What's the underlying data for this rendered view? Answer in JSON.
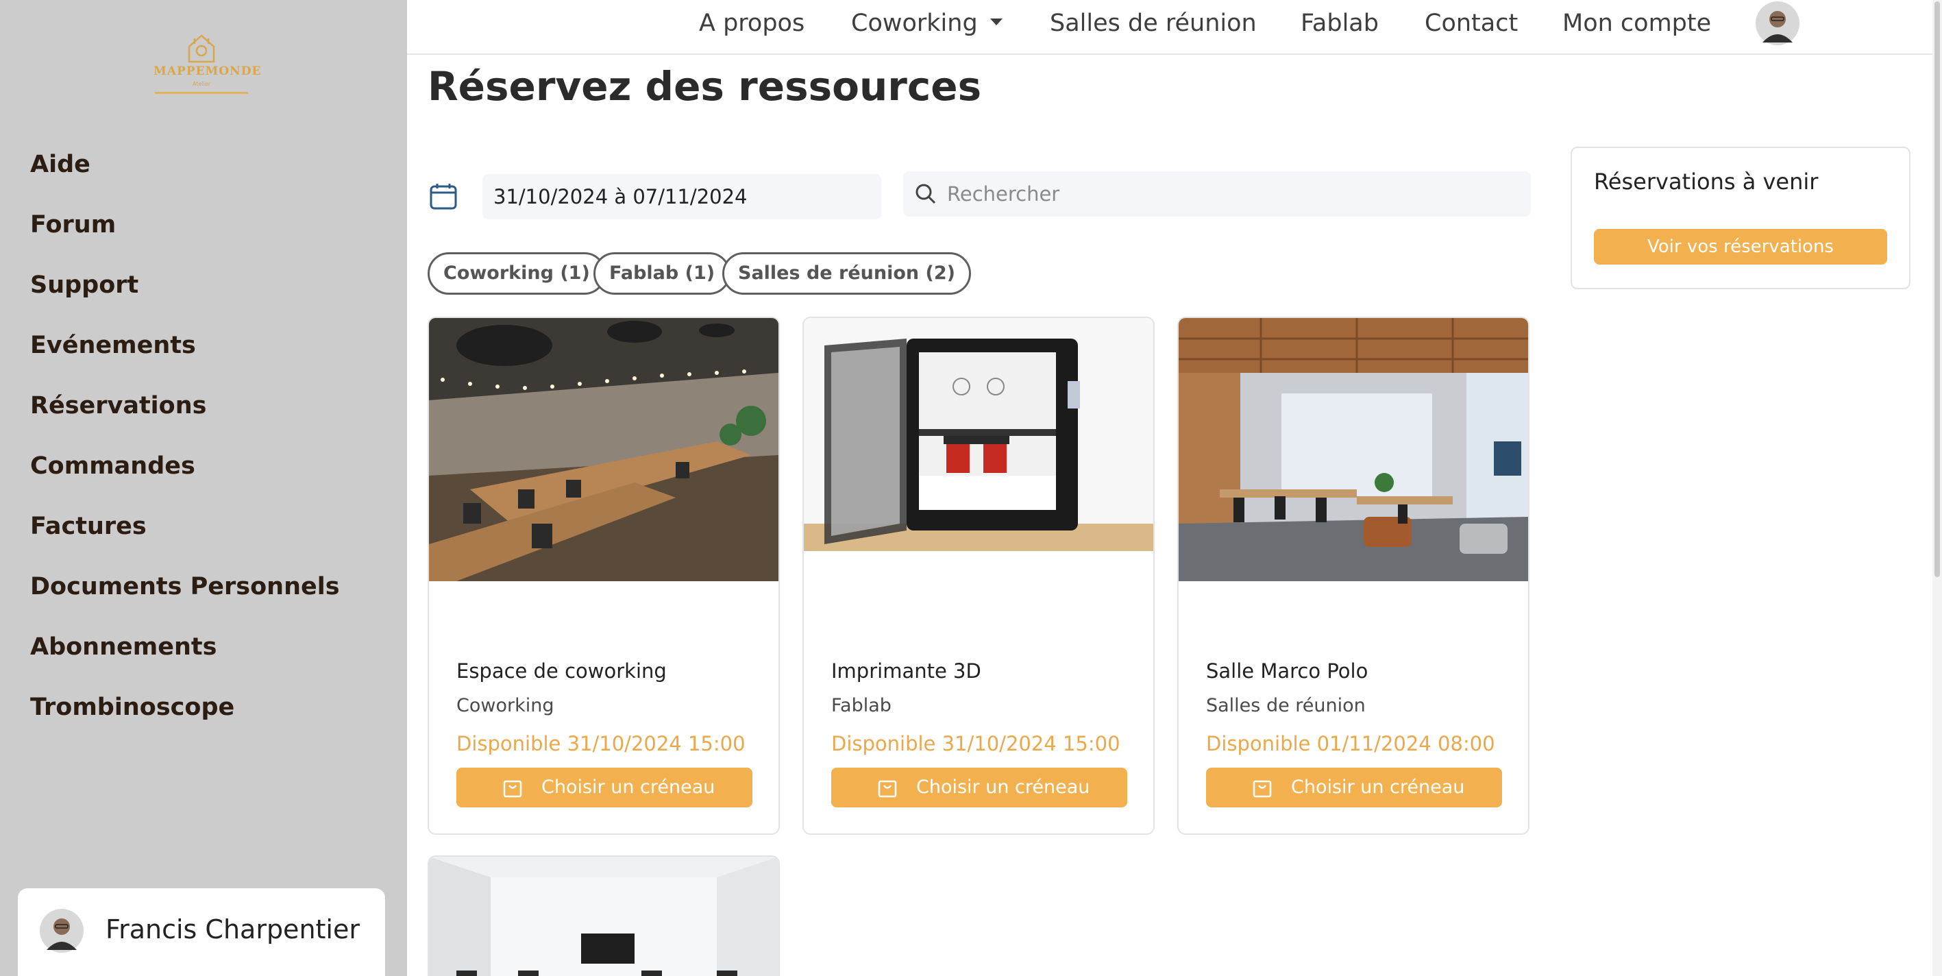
{
  "brand": {
    "name": "MAPPEMONDE",
    "sub": "Atelier"
  },
  "sidebar": {
    "items": [
      {
        "label": "Aide"
      },
      {
        "label": "Forum"
      },
      {
        "label": "Support"
      },
      {
        "label": "Evénements"
      },
      {
        "label": "Réservations"
      },
      {
        "label": "Commandes"
      },
      {
        "label": "Factures"
      },
      {
        "label": "Documents Personnels"
      },
      {
        "label": "Abonnements"
      },
      {
        "label": "Trombinoscope"
      }
    ],
    "user": {
      "name": "Francis Charpentier"
    }
  },
  "topnav": {
    "items": [
      {
        "label": "A propos"
      },
      {
        "label": "Coworking"
      },
      {
        "label": "Salles de réunion"
      },
      {
        "label": "Fablab"
      },
      {
        "label": "Contact"
      },
      {
        "label": "Mon compte"
      }
    ]
  },
  "main": {
    "title": "Réservez des ressources",
    "date_range": "31/10/2024 à 07/11/2024",
    "search": {
      "placeholder": "Rechercher",
      "value": ""
    },
    "filters": [
      {
        "label": "Coworking (1)"
      },
      {
        "label": "Fablab (1)"
      },
      {
        "label": "Salles de réunion (2)"
      }
    ],
    "cards": [
      {
        "title": "Espace de coworking",
        "category": "Coworking",
        "availability": "Disponible 31/10/2024 15:00",
        "button": "Choisir un créneau"
      },
      {
        "title": "Imprimante 3D",
        "category": "Fablab",
        "availability": "Disponible 31/10/2024 15:00",
        "button": "Choisir un créneau"
      },
      {
        "title": "Salle Marco Polo",
        "category": "Salles de réunion",
        "availability": "Disponible 01/11/2024 08:00",
        "button": "Choisir un créneau"
      }
    ]
  },
  "upcoming": {
    "title": "Réservations à venir",
    "button": "Voir vos réservations"
  },
  "colors": {
    "accent": "#f2b04e",
    "availability": "#eba84a",
    "sidebar_bg": "#cccccc",
    "brand": "#d9a64b"
  },
  "icons": [
    "house-logo-icon",
    "calendar-icon",
    "search-icon",
    "shopping-bag-icon",
    "chevron-down-icon",
    "avatar"
  ]
}
